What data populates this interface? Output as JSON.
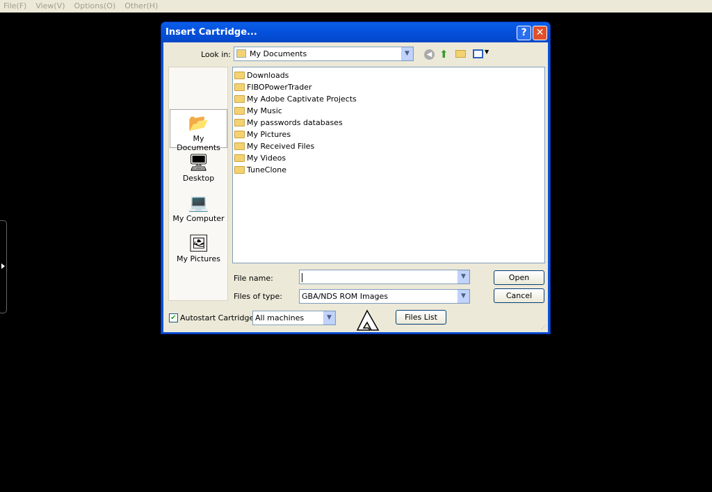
{
  "menu": [
    "File(F)",
    "View(V)",
    "Options(O)",
    "Other(H)"
  ],
  "dialog": {
    "title": "Insert Cartridge...",
    "help": "?",
    "close": "✕",
    "look_in_label": "Look in:",
    "look_in_value": "My Documents",
    "places": [
      {
        "label": "My Documents",
        "icon": "my-documents-icon"
      },
      {
        "label": "Desktop",
        "icon": "desktop-icon"
      },
      {
        "label": "My Computer",
        "icon": "my-computer-icon"
      },
      {
        "label": "My Pictures",
        "icon": "my-pictures-icon"
      }
    ],
    "files": [
      "Downloads",
      "FIBOPowerTrader",
      "My Adobe Captivate Projects",
      "My Music",
      "My passwords databases",
      "My Pictures",
      "My Received Files",
      "My Videos",
      "TuneClone"
    ],
    "file_name_label": "File name:",
    "file_name_value": "",
    "files_of_type_label": "Files of type:",
    "files_of_type_value": "GBA/NDS ROM Images",
    "open": "Open",
    "cancel": "Cancel",
    "autostart_label": "Autostart Cartridge",
    "autostart_checked": true,
    "machine_value": "All machines",
    "files_list": "Files List"
  }
}
